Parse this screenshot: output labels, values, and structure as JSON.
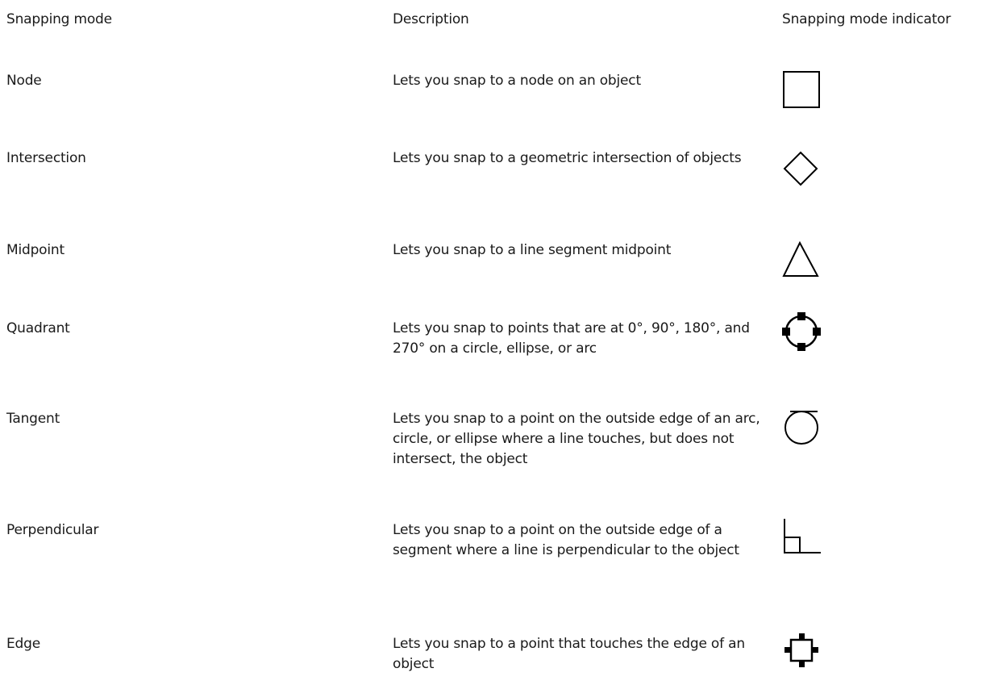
{
  "headers": {
    "mode": "Snapping mode",
    "description": "Description",
    "indicator": "Snapping mode indicator"
  },
  "rows": [
    {
      "mode": "Node",
      "description": "Lets you snap to a node on an object",
      "icon": "square-icon"
    },
    {
      "mode": "Intersection",
      "description": "Lets you snap to a geometric intersection of objects",
      "icon": "diamond-icon"
    },
    {
      "mode": "Midpoint",
      "description": "Lets you snap to a line segment midpoint",
      "icon": "triangle-icon"
    },
    {
      "mode": "Quadrant",
      "description": "Lets you snap to points that are at 0°, 90°, 180°, and 270° on a circle, ellipse, or arc",
      "icon": "quadrant-circle-icon"
    },
    {
      "mode": "Tangent",
      "description": "Lets you snap to a point on the outside edge of an arc, circle, or ellipse where a line touches, but does not intersect, the object",
      "icon": "tangent-circle-icon"
    },
    {
      "mode": "Perpendicular",
      "description": "Lets you snap to a point on the outside edge of a segment where a line is perpendicular to the object",
      "icon": "perpendicular-icon"
    },
    {
      "mode": "Edge",
      "description": "Lets you snap to a point that touches the edge of an object",
      "icon": "edge-icon"
    }
  ],
  "colors": {
    "text": "#1a1a1a",
    "icon_stroke": "#000000"
  }
}
